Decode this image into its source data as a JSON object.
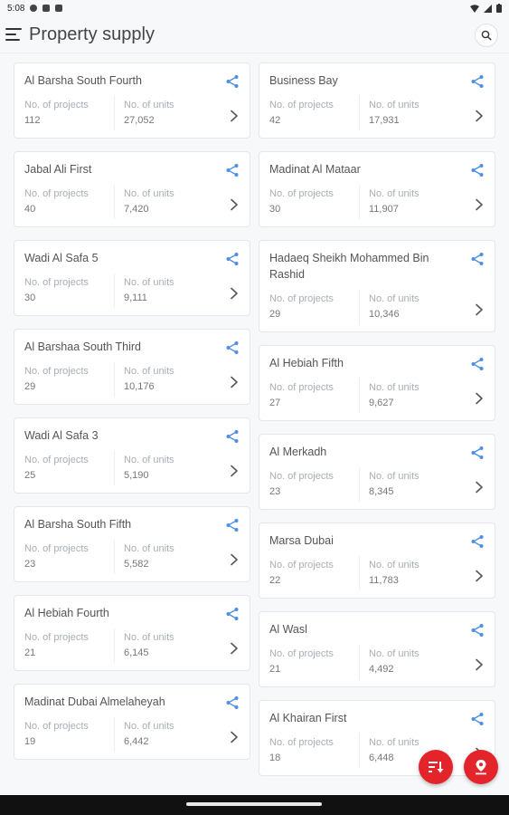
{
  "status_bar": {
    "time": "5:08"
  },
  "app_bar": {
    "title": "Property supply"
  },
  "labels": {
    "projects": "No. of projects",
    "units": "No. of units"
  },
  "left_cards": [
    {
      "name": "Al Barsha South Fourth",
      "projects": "112",
      "units": "27,052"
    },
    {
      "name": "Jabal Ali First",
      "projects": "40",
      "units": "7,420"
    },
    {
      "name": "Wadi Al Safa 5",
      "projects": "30",
      "units": "9,111"
    },
    {
      "name": "Al Barshaa South Third",
      "projects": "29",
      "units": "10,176"
    },
    {
      "name": "Wadi Al Safa 3",
      "projects": "25",
      "units": "5,190"
    },
    {
      "name": "Al Barsha South Fifth",
      "projects": "23",
      "units": "5,582"
    },
    {
      "name": "Al Hebiah Fourth",
      "projects": "21",
      "units": "6,145"
    },
    {
      "name": "Madinat Dubai Almelaheyah",
      "projects": "19",
      "units": "6,442"
    }
  ],
  "right_cards": [
    {
      "name": "Business Bay",
      "projects": "42",
      "units": "17,931"
    },
    {
      "name": "Madinat Al Mataar",
      "projects": "30",
      "units": "11,907"
    },
    {
      "name": "Hadaeq Sheikh Mohammed Bin Rashid",
      "projects": "29",
      "units": "10,346"
    },
    {
      "name": "Al Hebiah Fifth",
      "projects": "27",
      "units": "9,627"
    },
    {
      "name": "Al Merkadh",
      "projects": "23",
      "units": "8,345"
    },
    {
      "name": "Marsa Dubai",
      "projects": "22",
      "units": "11,783"
    },
    {
      "name": "Al Wasl",
      "projects": "21",
      "units": "4,492"
    },
    {
      "name": "Al Khairan First",
      "projects": "18",
      "units": "6,448"
    }
  ],
  "icons": {
    "menu": "menu-icon",
    "search": "search-icon",
    "share": "share-icon",
    "chevron": "chevron-right-icon",
    "sort": "sort-icon",
    "map": "map-pin-icon"
  },
  "colors": {
    "accent": "#e3242b",
    "share_blue": "#4a8fe7"
  }
}
